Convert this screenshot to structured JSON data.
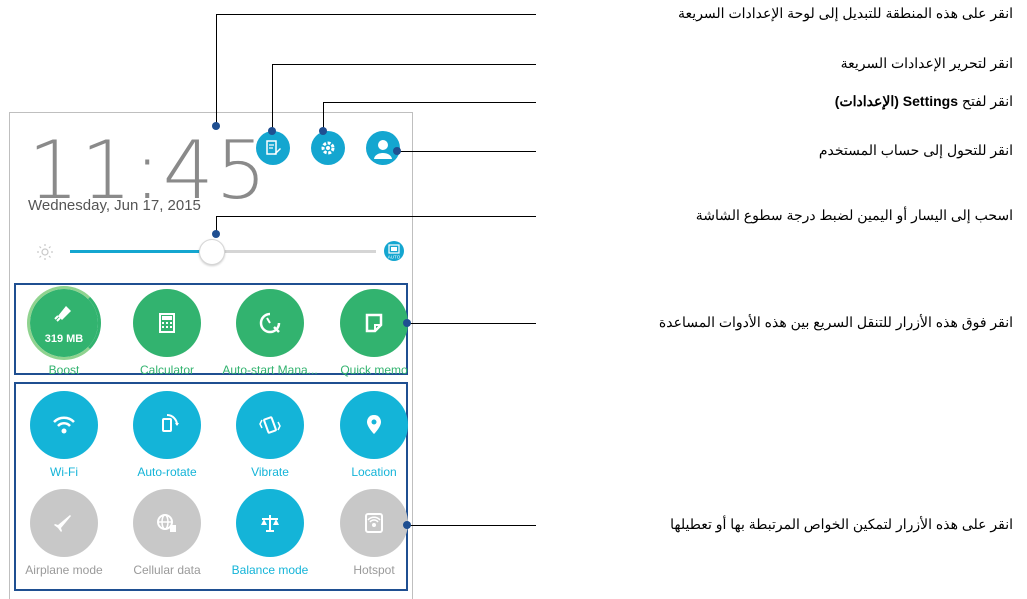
{
  "status": {
    "time": "11:45",
    "date": "Wednesday, Jun 17, 2015"
  },
  "brightness": {
    "level_percent": 46,
    "auto_label": "AUTO"
  },
  "shortcuts": [
    {
      "label": "Boost",
      "icon": "rocket-icon",
      "badge": "319 MB"
    },
    {
      "label": "Calculator",
      "icon": "calculator-icon"
    },
    {
      "label": "Auto-start Mana...",
      "icon": "auto-start-icon"
    },
    {
      "label": "Quick memo",
      "icon": "memo-icon"
    }
  ],
  "toggles": [
    {
      "label": "Wi-Fi",
      "icon": "wifi-icon",
      "on": true
    },
    {
      "label": "Auto-rotate",
      "icon": "auto-rotate-icon",
      "on": true
    },
    {
      "label": "Vibrate",
      "icon": "vibrate-icon",
      "on": true
    },
    {
      "label": "Location",
      "icon": "location-icon",
      "on": true
    },
    {
      "label": "Airplane mode",
      "icon": "airplane-icon",
      "on": false
    },
    {
      "label": "Cellular data",
      "icon": "cellular-data-icon",
      "on": false
    },
    {
      "label": "Balance mode",
      "icon": "balance-icon",
      "on": true
    },
    {
      "label": "Hotspot",
      "icon": "hotspot-icon",
      "on": false
    }
  ],
  "callouts": {
    "switch_panel": "انقر على هذه المنطقة للتبديل إلى لوحة الإعدادات السريعة",
    "edit_settings": "انقر لتحرير الإعدادات السريعة",
    "open_settings_prefix": "انقر لفتح",
    "open_settings_bold": "Settings (الإعدادات)",
    "user_account": "انقر للتحول إلى حساب المستخدم",
    "brightness": "اسحب إلى اليسار أو اليمين لضبط درجة سطوع الشاشة",
    "shortcuts": "انقر فوق هذه الأزرار للتنقل السريع بين هذه الأدوات المساعدة",
    "toggles": "انقر على هذه الأزرار لتمكين الخواص المرتبطة بها أو تعطيلها"
  },
  "colors": {
    "accent": "#14a6d0",
    "green": "#32b36f",
    "off": "#c8c8c8",
    "callout_dot": "#1f4f91"
  }
}
